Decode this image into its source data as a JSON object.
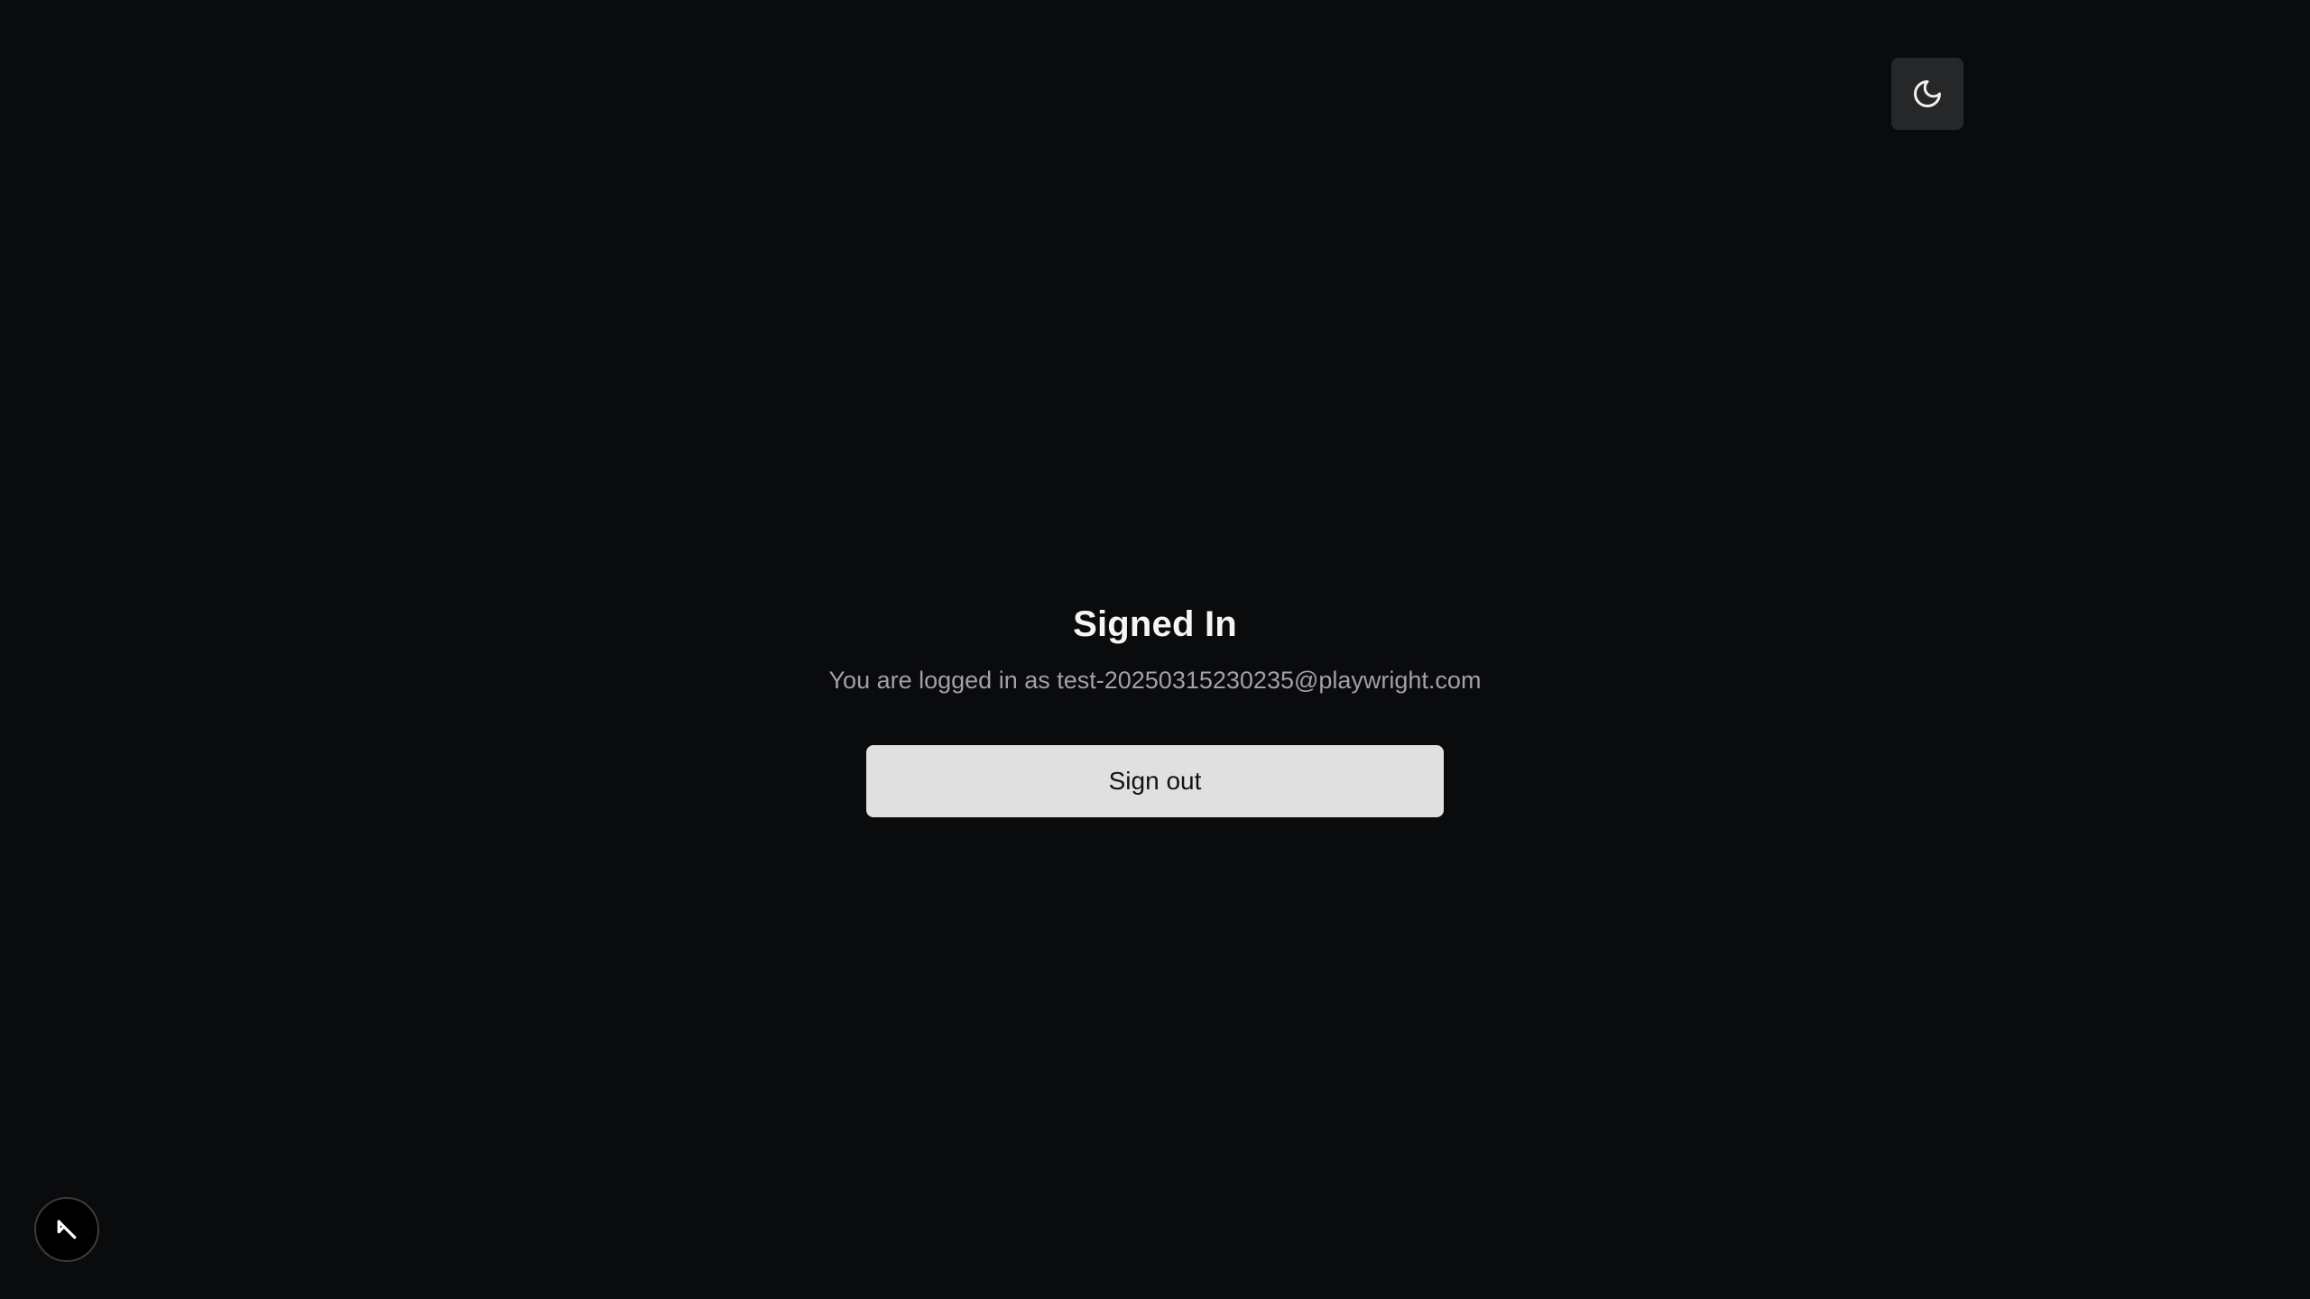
{
  "header": {
    "theme_toggle_icon": "moon-icon"
  },
  "main": {
    "title": "Signed In",
    "subtitle": "You are logged in as test-20250315230235@playwright.com",
    "signout_label": "Sign out"
  },
  "corner_badge": {
    "icon": "arrow-up-left-icon"
  },
  "colors": {
    "background": "#0a0b0d",
    "toggle_bg": "#262729",
    "button_bg": "#e0e0e0",
    "title": "#f5f5f5",
    "subtitle": "#a1a1a6"
  }
}
